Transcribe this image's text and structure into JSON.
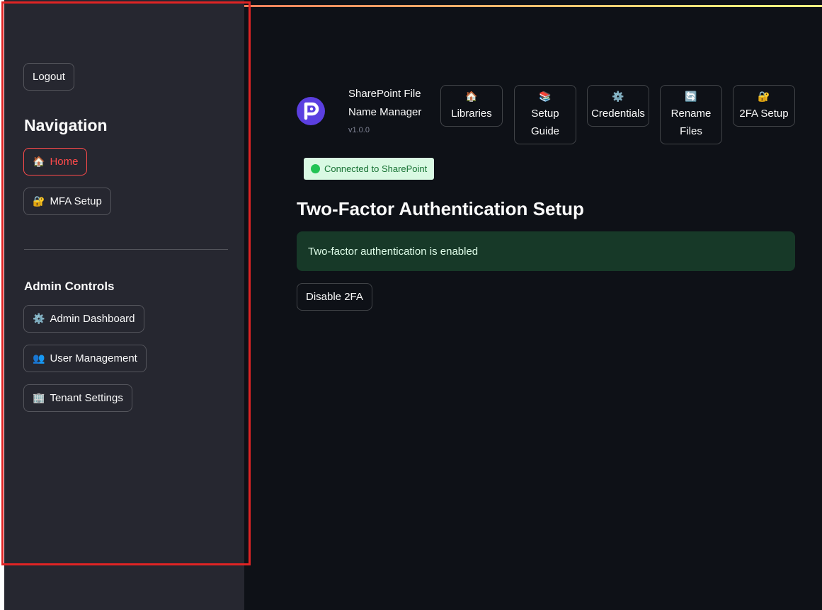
{
  "sidebar": {
    "logout_label": "Logout",
    "navigation_heading": "Navigation",
    "nav_items": [
      {
        "icon": "🏠",
        "label": "Home",
        "active": true
      },
      {
        "icon": "🔐",
        "label": "MFA Setup",
        "active": false
      }
    ],
    "admin_heading": "Admin Controls",
    "admin_items": [
      {
        "icon": "⚙️",
        "label": "Admin Dashboard"
      },
      {
        "icon": "👥",
        "label": "User Management"
      },
      {
        "icon": "🏢",
        "label": "Tenant Settings"
      }
    ]
  },
  "header": {
    "app_title": "SharePoint File Name Manager",
    "version": "v1.0.0",
    "nav": [
      {
        "icon": "🏠",
        "label": "Libraries"
      },
      {
        "icon": "📚",
        "label": "Setup Guide"
      },
      {
        "icon": "⚙️",
        "label": "Credentials"
      },
      {
        "icon": "🔄",
        "label": "Rename Files"
      },
      {
        "icon": "🔐",
        "label": "2FA Setup"
      }
    ]
  },
  "status": {
    "label": "Connected to SharePoint",
    "color": "#21c354"
  },
  "main": {
    "title": "Two-Factor Authentication Setup",
    "alert_text": "Two-factor authentication is enabled",
    "disable_label": "Disable 2FA"
  },
  "colors": {
    "accent": "#ff4b4b",
    "background": "#0e1117",
    "sidebar": "#262730",
    "success": "#21c354"
  }
}
